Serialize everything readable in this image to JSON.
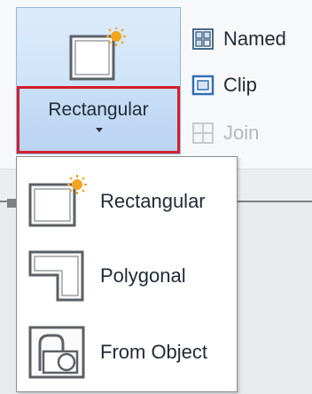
{
  "ribbon": {
    "clip_split_button": {
      "label": "Rectangular"
    },
    "small_buttons": [
      {
        "label": "Named",
        "icon": "named-view-icon",
        "enabled": true
      },
      {
        "label": "Clip",
        "icon": "clip-icon",
        "enabled": true
      },
      {
        "label": "Join",
        "icon": "join-icon",
        "enabled": false
      }
    ]
  },
  "dropdown": {
    "items": [
      {
        "label": "Rectangular",
        "icon": "rectangle-new-icon"
      },
      {
        "label": "Polygonal",
        "icon": "polygon-icon"
      },
      {
        "label": "From Object",
        "icon": "from-object-icon"
      }
    ]
  },
  "colors": {
    "highlight_border": "#d4202a",
    "button_fill": "#c4ddf6",
    "icon_star": "#f2a51f"
  }
}
